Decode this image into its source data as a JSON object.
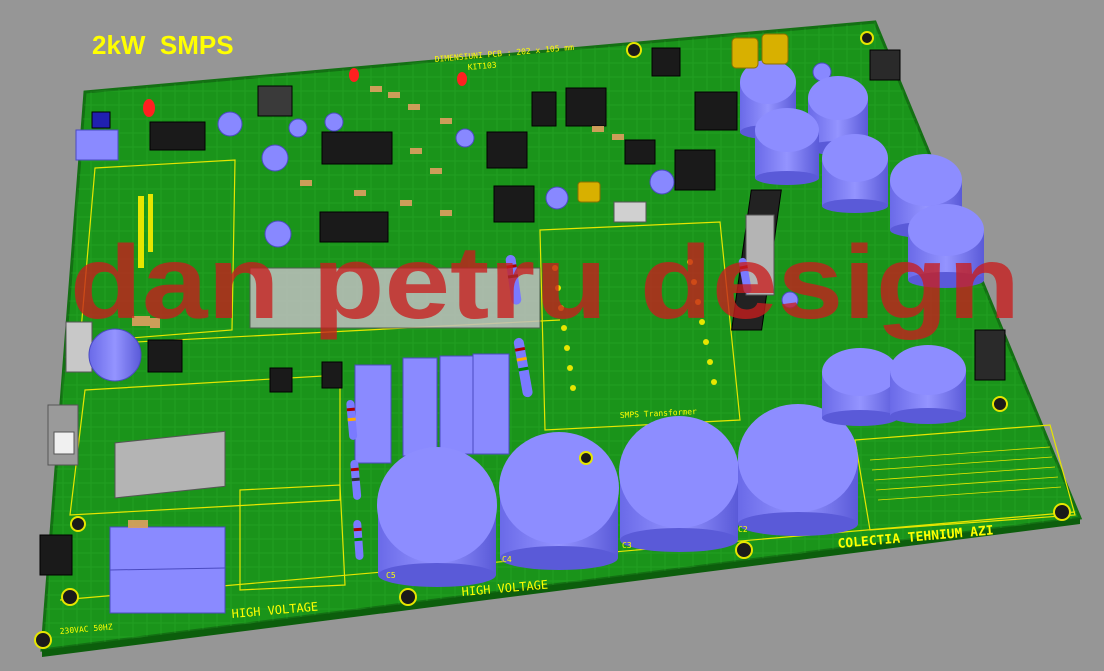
{
  "viewer": {
    "title": "2kW  SMPS"
  },
  "pcb": {
    "silk_dimension": "DIMENSIUNI PCB : 202 x 105 mm",
    "silk_kit": "KIT103",
    "silk_hv_left": "HIGH VOLTAGE",
    "silk_hv_center": "HIGH VOLTAGE",
    "silk_transformer": "SMPS Transformer",
    "silk_collection": "COLECTIA TEHNIUM AZI",
    "silk_mains": "230VAC 50HZ",
    "silk_caps": [
      "C5",
      "C4",
      "C3",
      "C2"
    ],
    "watermark": "dan petru design"
  },
  "colors": {
    "board": "#1e9a1e",
    "capacitor": "#8080ff",
    "silkscreen": "#ffff00",
    "background": "#969696",
    "watermark": "#c81e1e"
  },
  "icons": [
    "mounting-hole-icon",
    "electrolytic-capacitor-icon",
    "resistor-icon",
    "ic-chip-icon"
  ]
}
